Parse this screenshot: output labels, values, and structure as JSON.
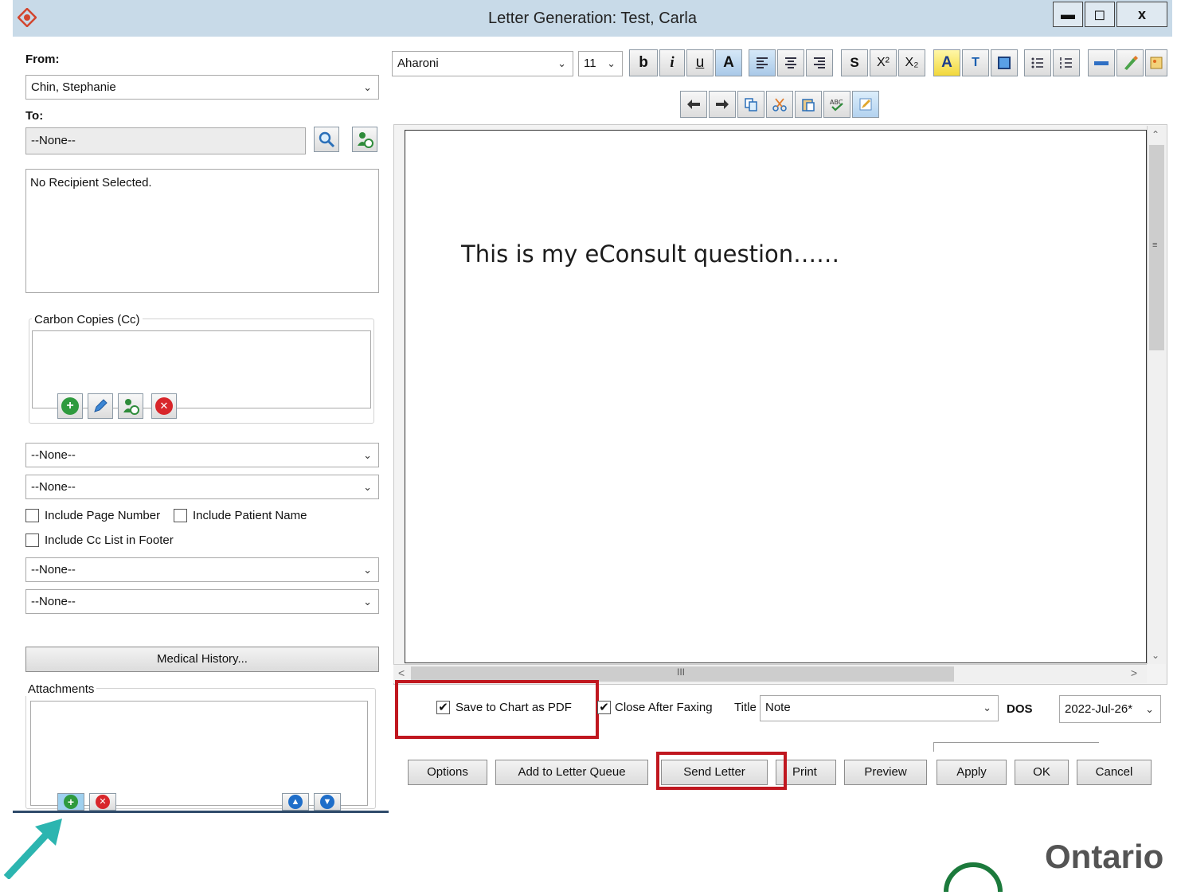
{
  "window": {
    "title": "Letter Generation: Test, Carla",
    "controls": {
      "minimize": "▬",
      "maximize": "◻",
      "close": "x"
    }
  },
  "left": {
    "from_label": "From:",
    "from_value": "Chin, Stephanie",
    "to_label": "To:",
    "to_value": "--None--",
    "recipient_text": "No Recipient Selected.",
    "cc_group_label": "Carbon Copies (Cc)",
    "combo1": "--None--",
    "combo2": "--None--",
    "include_page_number": "Include Page Number",
    "include_patient_name": "Include Patient Name",
    "include_cc_list": "Include Cc List in Footer",
    "combo3": "--None--",
    "combo4": "--None--",
    "medical_history_button": "Medical History...",
    "attachments_label": "Attachments"
  },
  "toolbar": {
    "font": "Aharoni",
    "size": "11",
    "bold": "b",
    "italic": "i",
    "underline": "u",
    "font_color": "A",
    "strike": "S",
    "superscript": "X²",
    "subscript": "X₂",
    "highlight_color": "A",
    "textbox": "T"
  },
  "editor": {
    "body_text": "This is my eConsult question……"
  },
  "bottom": {
    "save_to_chart_pdf": "Save to Chart as PDF",
    "close_after_faxing": "Close After Faxing",
    "title_label": "Title",
    "title_value": "Note",
    "dos_label": "DOS",
    "dos_value": "2022-Jul-26*",
    "buttons": {
      "options": "Options",
      "add_to_queue": "Add to Letter Queue",
      "send_letter": "Send Letter",
      "print": "Print",
      "preview": "Preview",
      "apply": "Apply",
      "ok": "OK",
      "cancel": "Cancel"
    }
  },
  "footer": {
    "brand": "Ontario"
  },
  "colors": {
    "highlight": "#c0171f",
    "arrow": "#2cb5b0",
    "titlebar": "#c8dae8",
    "brand_ring": "#1c7a3c"
  }
}
